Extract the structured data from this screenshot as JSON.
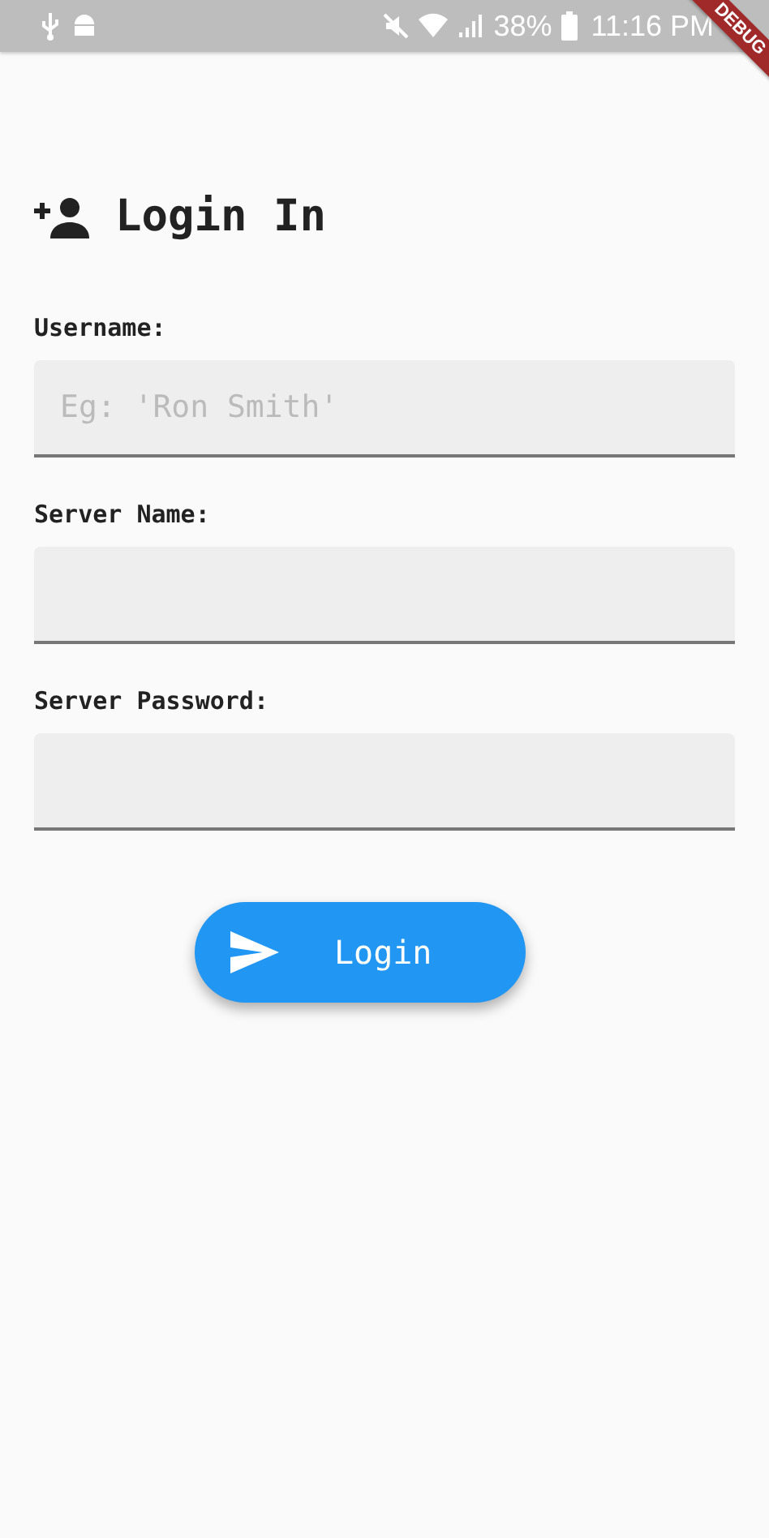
{
  "status_bar": {
    "battery": "38%",
    "time": "11:16 PM"
  },
  "debug_banner": {
    "label": "DEBUG"
  },
  "title": "Login In",
  "fields": [
    {
      "label": "Username:",
      "placeholder": "Eg: 'Ron Smith'"
    },
    {
      "label": "Server Name:"
    },
    {
      "label": "Server Password:"
    }
  ],
  "button": {
    "label": "Login"
  }
}
